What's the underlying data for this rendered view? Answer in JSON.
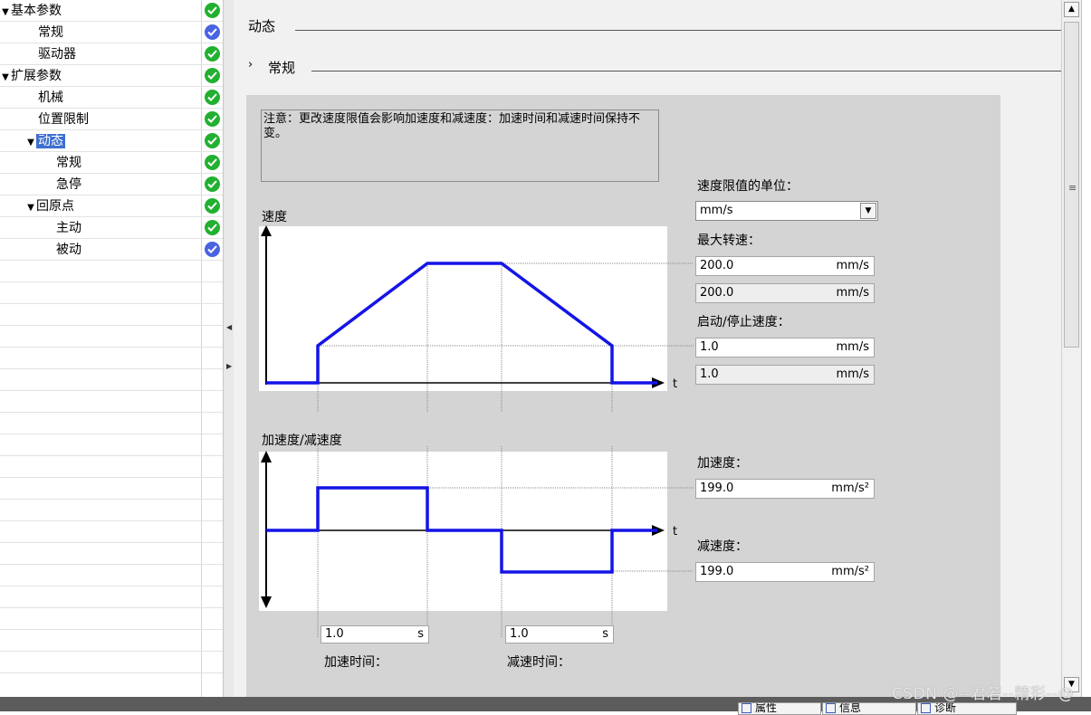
{
  "tree": {
    "items": [
      {
        "label": "基本参数",
        "level": 0,
        "expanded": true,
        "status": "ok"
      },
      {
        "label": "常规",
        "level": 1,
        "status": "blue"
      },
      {
        "label": "驱动器",
        "level": 1,
        "status": "ok"
      },
      {
        "label": "扩展参数",
        "level": 0,
        "expanded": true,
        "status": "ok"
      },
      {
        "label": "机械",
        "level": 1,
        "status": "ok"
      },
      {
        "label": "位置限制",
        "level": 1,
        "status": "ok"
      },
      {
        "label": "动态",
        "level": 1,
        "expanded": true,
        "selected": true,
        "status": "ok"
      },
      {
        "label": "常规",
        "level": 2,
        "status": "ok"
      },
      {
        "label": "急停",
        "level": 2,
        "status": "ok"
      },
      {
        "label": "回原点",
        "level": 1,
        "expanded": true,
        "status": "ok"
      },
      {
        "label": "主动",
        "level": 2,
        "status": "ok"
      },
      {
        "label": "被动",
        "level": 2,
        "status": "blue"
      }
    ]
  },
  "main": {
    "section_title": "动态",
    "subsection_title": "常规",
    "note": "注意：更改速度限值会影响加速度和减速度：加速时间和减速时间保持不变。",
    "speed_chart_label": "速度",
    "accel_chart_label": "加速度/减速度",
    "time_axis_label": "t",
    "speed_unit_label": "速度限值的单位：",
    "speed_unit_value": "mm/s",
    "max_speed_label": "最大转速：",
    "max_speed_value": "200.0",
    "max_speed_unit": "mm/s",
    "max_speed_readonly_value": "200.0",
    "max_speed_readonly_unit": "mm/s",
    "start_stop_label": "启动/停止速度：",
    "start_stop_value": "1.0",
    "start_stop_unit": "mm/s",
    "start_stop_readonly_value": "1.0",
    "start_stop_readonly_unit": "mm/s",
    "accel_label": "加速度：",
    "accel_value": "199.0",
    "accel_unit": "mm/s²",
    "decel_label": "减速度：",
    "decel_value": "199.0",
    "decel_unit": "mm/s²",
    "accel_time_value": "1.0",
    "accel_time_unit": "s",
    "accel_time_label": "加速时间：",
    "decel_time_value": "1.0",
    "decel_time_unit": "s",
    "decel_time_label": "减速时间："
  },
  "bottom_tabs": [
    {
      "label": "属性",
      "icon": "properties-icon"
    },
    {
      "label": "信息",
      "icon": "info-icon"
    },
    {
      "label": "诊断",
      "icon": "diagnostics-icon"
    }
  ],
  "watermark": "CSDN @--君若--精彩--@",
  "colors": {
    "status_ok": "#22b030",
    "status_blue": "#4a63e0",
    "selection": "#3d6fd0",
    "profile_line": "#1414e6",
    "panel_bg": "#d4d4d4"
  }
}
